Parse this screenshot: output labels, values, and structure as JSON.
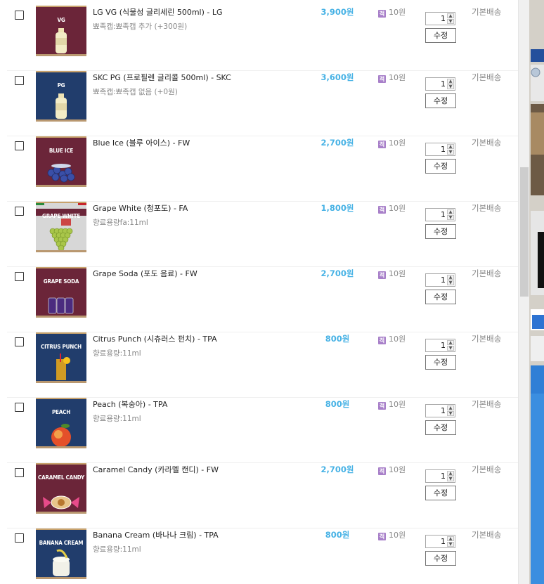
{
  "currency_suffix": "원",
  "items": [
    {
      "name": "LG VG (식물성 글리세린 500ml) - LG",
      "option": "뾰족캡:뾰족캡 추가 (+300원)",
      "price": "3,900원",
      "points": "10원",
      "qty": "1",
      "edit": "수정",
      "shipping": "기본배송",
      "thumb": {
        "label": "VG",
        "sub": "",
        "bg": "#6b2539",
        "art": "bottle"
      }
    },
    {
      "name": "SKC PG (프로필렌 글리콜 500ml) - SKC",
      "option": "뾰족캡:뾰족캡 없음 (+0원)",
      "price": "3,600원",
      "points": "10원",
      "qty": "1",
      "edit": "수정",
      "shipping": "기본배송",
      "thumb": {
        "label": "PG",
        "sub": "",
        "bg": "#213d6c",
        "art": "bottle"
      }
    },
    {
      "name": "Blue Ice (블루 아이스) - FW",
      "option": "",
      "price": "2,700원",
      "points": "10원",
      "qty": "1",
      "edit": "수정",
      "shipping": "기본배송",
      "thumb": {
        "label": "BLUE ICE",
        "sub": "",
        "bg": "#6b2539",
        "art": "berries"
      }
    },
    {
      "name": "Grape White (청포도) - FA",
      "option": "향료용량fa:11ml",
      "price": "1,800원",
      "points": "10원",
      "qty": "1",
      "edit": "수정",
      "shipping": "기본배송",
      "thumb": {
        "label": "GRAPE WHITE",
        "sub": "",
        "bg": "#d7d7d7",
        "art": "grapes"
      }
    },
    {
      "name": "Grape Soda (포도 음료) - FW",
      "option": "",
      "price": "2,700원",
      "points": "10원",
      "qty": "1",
      "edit": "수정",
      "shipping": "기본배송",
      "thumb": {
        "label": "GRAPE SODA",
        "sub": "",
        "bg": "#6b2539",
        "art": "cans"
      }
    },
    {
      "name": "Citrus Punch (시츄러스 펀치) - TPA",
      "option": "향료용량:11ml",
      "price": "800원",
      "points": "10원",
      "qty": "1",
      "edit": "수정",
      "shipping": "기본배송",
      "thumb": {
        "label": "CITRUS PUNCH",
        "sub": "",
        "bg": "#213d6c",
        "art": "glass"
      }
    },
    {
      "name": "Peach (복숭아) - TPA",
      "option": "향료용량:11ml",
      "price": "800원",
      "points": "10원",
      "qty": "1",
      "edit": "수정",
      "shipping": "기본배송",
      "thumb": {
        "label": "PEACH",
        "sub": "",
        "bg": "#213d6c",
        "art": "peach"
      }
    },
    {
      "name": "Caramel Candy (카라멜 캔디) - FW",
      "option": "",
      "price": "2,700원",
      "points": "10원",
      "qty": "1",
      "edit": "수정",
      "shipping": "기본배송",
      "thumb": {
        "label": "CARAMEL CANDY",
        "sub": "",
        "bg": "#6b2539",
        "art": "candy"
      }
    },
    {
      "name": "Banana Cream (바나나 크림) - TPA",
      "option": "향료용량:11ml",
      "price": "800원",
      "points": "10원",
      "qty": "1",
      "edit": "수정",
      "shipping": "기본배송",
      "thumb": {
        "label": "BANANA CREAM",
        "sub": "",
        "bg": "#213d6c",
        "art": "cream"
      }
    }
  ],
  "points_icon_glyph": "적",
  "spinner": {
    "up": "▲",
    "down": "▼"
  }
}
